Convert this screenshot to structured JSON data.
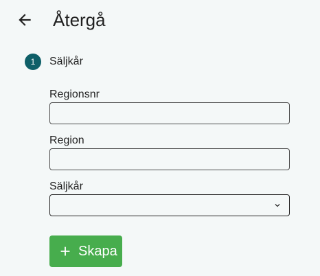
{
  "header": {
    "title": "Återgå",
    "back_icon": "arrow-left-icon"
  },
  "stepper": {
    "step_number": "1",
    "step_label": "Säljkår",
    "step_color": "#0e5f68"
  },
  "form": {
    "regionsnr": {
      "label": "Regionsnr",
      "value": ""
    },
    "region": {
      "label": "Region",
      "value": ""
    },
    "saljkar": {
      "label": "Säljkår",
      "selected": "",
      "icon": "chevron-down-icon"
    }
  },
  "actions": {
    "create_label": "Skapa",
    "create_icon": "plus-icon",
    "create_color": "#47ad4d"
  }
}
